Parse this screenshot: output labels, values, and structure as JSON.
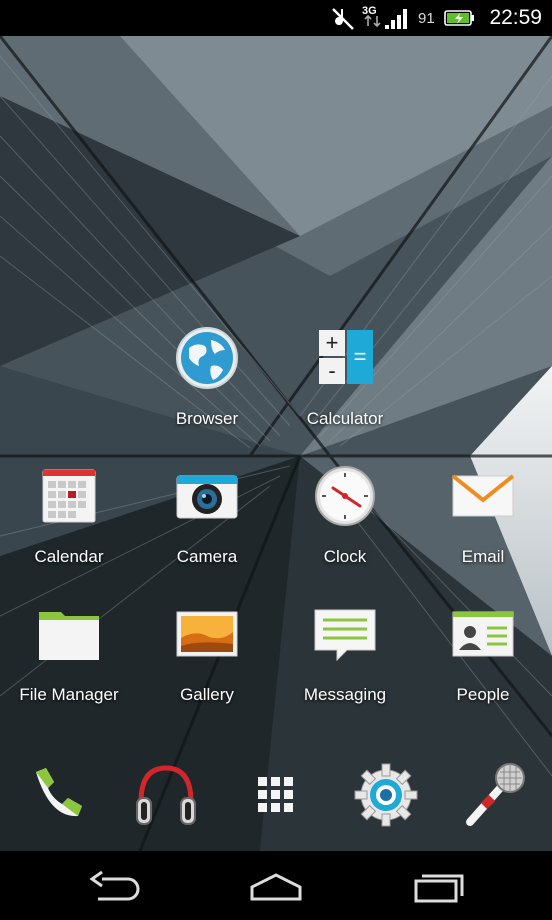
{
  "status_bar": {
    "network_type": "3G",
    "battery_percent": "91",
    "time": "22:59",
    "icons": [
      "mute-icon",
      "signal-icon",
      "battery-charging-icon"
    ]
  },
  "apps": [
    {
      "label": "Browser",
      "icon": "globe-icon"
    },
    {
      "label": "Calculator",
      "icon": "calculator-icon"
    },
    {
      "label": "Calendar",
      "icon": "calendar-icon"
    },
    {
      "label": "Camera",
      "icon": "camera-icon"
    },
    {
      "label": "Clock",
      "icon": "clock-icon"
    },
    {
      "label": "Email",
      "icon": "envelope-icon"
    },
    {
      "label": "File Manager",
      "icon": "folder-icon"
    },
    {
      "label": "Gallery",
      "icon": "picture-icon"
    },
    {
      "label": "Messaging",
      "icon": "message-bubble-icon"
    },
    {
      "label": "People",
      "icon": "contact-card-icon"
    }
  ],
  "calculator_symbols": [
    "+",
    "-",
    "="
  ],
  "dock": [
    "phone-icon",
    "headphones-icon",
    "app-drawer-icon",
    "settings-gear-icon",
    "microphone-icon"
  ],
  "nav": [
    "back-icon",
    "home-icon",
    "recent-apps-icon"
  ],
  "colors": {
    "accent_green": "#8cc63f",
    "calculator_blue": "#1ea9d6",
    "email_orange": "#f08c1e"
  }
}
